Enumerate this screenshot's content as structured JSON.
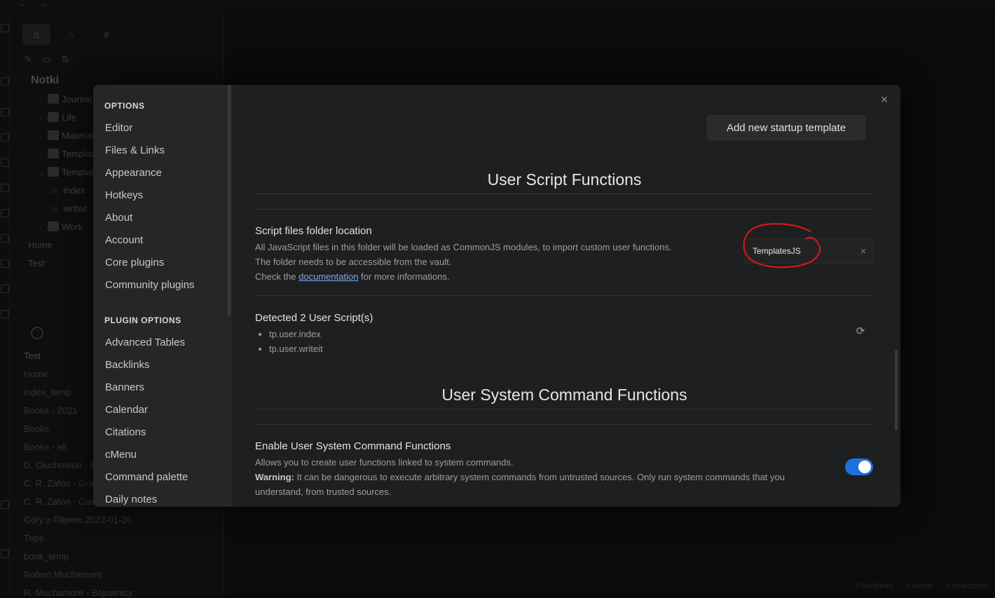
{
  "background": {
    "vault_name": "Notki",
    "tree": [
      {
        "label": "Journal",
        "icon": "journal-icon"
      },
      {
        "label": "Life",
        "icon": "heart-icon"
      },
      {
        "label": "Materials",
        "icon": "image-icon"
      },
      {
        "label": "Templates",
        "icon": "template-icon"
      },
      {
        "label": "TemplatesJS",
        "icon": "code-icon"
      },
      {
        "label": "index",
        "icon": "js-icon"
      },
      {
        "label": "writeit",
        "icon": "js-icon"
      },
      {
        "label": "Work",
        "icon": "briefcase-icon"
      },
      {
        "label": "Home",
        "icon": ""
      },
      {
        "label": "Test",
        "icon": ""
      }
    ],
    "recent": [
      "Test",
      "Home",
      "index_temp",
      "Books - 2021",
      "Books",
      "Books - all",
      "D. Głuchowski - M",
      "C. R. Zafón - Gra",
      "C. R. Zafón - Cień",
      "Góry z Filipem 2022-01-26",
      "Trips",
      "book_temp",
      "Robert Muchamore",
      "R. Muchamore - Bojownicy"
    ],
    "status": [
      "0 backlinks",
      "0 words",
      "0 characters"
    ]
  },
  "modal": {
    "options_header": "OPTIONS",
    "options": [
      "Editor",
      "Files & Links",
      "Appearance",
      "Hotkeys",
      "About",
      "Account",
      "Core plugins",
      "Community plugins"
    ],
    "plugin_options_header": "PLUGIN OPTIONS",
    "plugin_options": [
      "Advanced Tables",
      "Backlinks",
      "Banners",
      "Calendar",
      "Citations",
      "cMenu",
      "Command palette",
      "Daily notes"
    ],
    "add_startup_button": "Add new startup template",
    "section1_heading": "User Script Functions",
    "script_folder": {
      "title": "Script files folder location",
      "desc1": "All JavaScript files in this folder will be loaded as CommonJS modules, to import custom user functions.",
      "desc2": "The folder needs to be accessible from the vault.",
      "desc3_prefix": "Check the ",
      "desc3_link": "documentation",
      "desc3_suffix": " for more informations.",
      "value": "TemplatesJS"
    },
    "detected": {
      "title": "Detected 2 User Script(s)",
      "items": [
        "tp.user.index",
        "tp.user.writeit"
      ]
    },
    "section2_heading": "User System Command Functions",
    "system_cmd": {
      "title": "Enable User System Command Functions",
      "desc1": "Allows you to create user functions linked to system commands.",
      "warning_label": "Warning:",
      "warning_text": " It can be dangerous to execute arbitrary system commands from untrusted sources. Only run system commands that you understand, from trusted sources.",
      "enabled": true
    },
    "colors": {
      "accent": "#1e6fe0",
      "annotation": "#d21818",
      "link": "#7fa6e8"
    }
  }
}
